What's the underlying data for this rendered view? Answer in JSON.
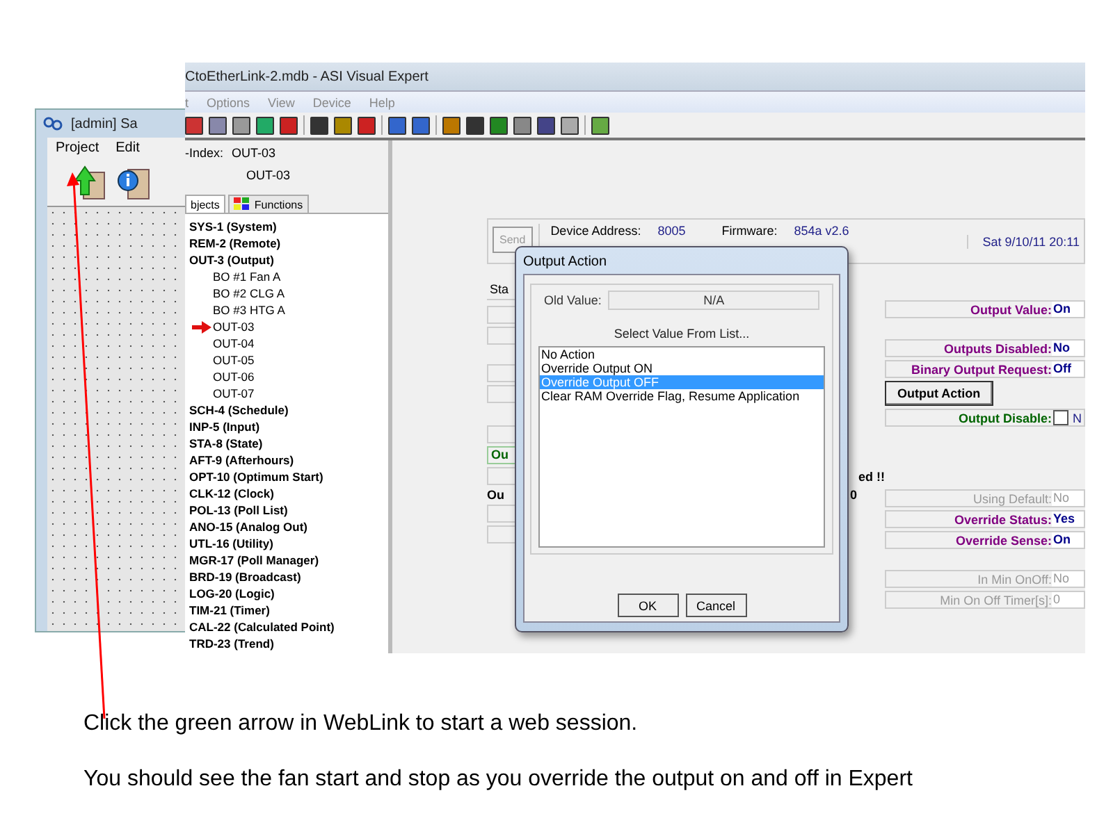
{
  "weblink_window": {
    "title": "[admin] Sa",
    "menu": [
      "Project",
      "Edit"
    ]
  },
  "expert_window": {
    "title": "CtoEtherLink-2.mdb - ASI Visual Expert",
    "menu": [
      "t",
      "Options",
      "View",
      "Device",
      "Help"
    ],
    "index_label": "-Index:",
    "index_value": "OUT-03",
    "object_name": "OUT-03",
    "tabs": [
      {
        "label": "bjects",
        "selected": true
      },
      {
        "label": "Functions",
        "selected": false
      }
    ],
    "tree": [
      {
        "label": "SYS-1 (System)"
      },
      {
        "label": "REM-2 (Remote)"
      },
      {
        "label": "OUT-3 (Output)",
        "children": [
          {
            "label": "BO #1 Fan A",
            "current": false
          },
          {
            "label": "BO #2 CLG A",
            "current": false
          },
          {
            "label": "BO #3 HTG A",
            "current": false
          },
          {
            "label": "OUT-03",
            "current": true
          },
          {
            "label": "OUT-04",
            "current": false
          },
          {
            "label": "OUT-05",
            "current": false
          },
          {
            "label": "OUT-06",
            "current": false
          },
          {
            "label": "OUT-07",
            "current": false
          }
        ]
      },
      {
        "label": "SCH-4 (Schedule)"
      },
      {
        "label": "INP-5 (Input)"
      },
      {
        "label": "STA-8 (State)"
      },
      {
        "label": "AFT-9 (Afterhours)"
      },
      {
        "label": "OPT-10 (Optimum Start)"
      },
      {
        "label": "CLK-12 (Clock)"
      },
      {
        "label": "POL-13 (Poll List)"
      },
      {
        "label": "ANO-15 (Analog Out)"
      },
      {
        "label": "UTL-16 (Utility)"
      },
      {
        "label": "MGR-17 (Poll Manager)"
      },
      {
        "label": "BRD-19 (Broadcast)"
      },
      {
        "label": "LOG-20 (Logic)"
      },
      {
        "label": "TIM-21 (Timer)"
      },
      {
        "label": "CAL-22 (Calculated Point)"
      },
      {
        "label": "TRD-23 (Trend)"
      }
    ],
    "header": {
      "send_button": "Send",
      "send_disabled": true,
      "device_address_label": "Device Address:",
      "device_address": "8005",
      "firmware_label": "Firmware:",
      "firmware": "854a v2.6",
      "datetime": "Sat  9/10/11  20:11"
    },
    "status_tab": "Sta",
    "left_fragments": {
      "green_label": "Ou",
      "warning_tail": "ed !!",
      "bold_label": "Ou",
      "bold_value": "0"
    },
    "field_groups": [
      [
        {
          "kind": "field",
          "label": "Output Value:",
          "value": "On",
          "disabled": false,
          "color": "#800080"
        }
      ],
      [
        {
          "kind": "field",
          "label": "Outputs Disabled:",
          "value": "No",
          "disabled": false,
          "color": "#800080"
        },
        {
          "kind": "field",
          "label": "Binary Output Request:",
          "value": "Off",
          "disabled": false,
          "color": "#800080"
        },
        {
          "kind": "button",
          "label": "Output Action"
        },
        {
          "kind": "checkbox",
          "label": "Output Disable:",
          "value": "N",
          "checked": false,
          "color": "#006400"
        }
      ],
      [
        {
          "kind": "field",
          "label": "Using Default:",
          "value": "No",
          "disabled": true
        },
        {
          "kind": "field",
          "label": "Override Status:",
          "value": "Yes",
          "disabled": false,
          "color": "#800080"
        },
        {
          "kind": "field",
          "label": "Override Sense:",
          "value": "On",
          "disabled": false,
          "color": "#800080"
        }
      ],
      [
        {
          "kind": "field",
          "label": "In Min OnOff:",
          "value": "No",
          "disabled": true
        },
        {
          "kind": "field",
          "label": "Min On Off Timer[s]:",
          "value": "0",
          "disabled": true
        }
      ]
    ]
  },
  "dialog": {
    "title": "Output Action",
    "old_value_label": "Old Value:",
    "old_value": "N/A",
    "list_prompt": "Select Value From List...",
    "options": [
      {
        "label": "No Action",
        "selected": false
      },
      {
        "label": "Override Output ON",
        "selected": false
      },
      {
        "label": "Override Output OFF",
        "selected": true
      },
      {
        "label": "Clear RAM Override Flag, Resume Application",
        "selected": false
      }
    ],
    "buttons": [
      "OK",
      "Cancel"
    ]
  },
  "captions": [
    "Click the green arrow in WebLink to start a web session.",
    "You should see the fan start and stop as you override the output on and off in Expert"
  ]
}
